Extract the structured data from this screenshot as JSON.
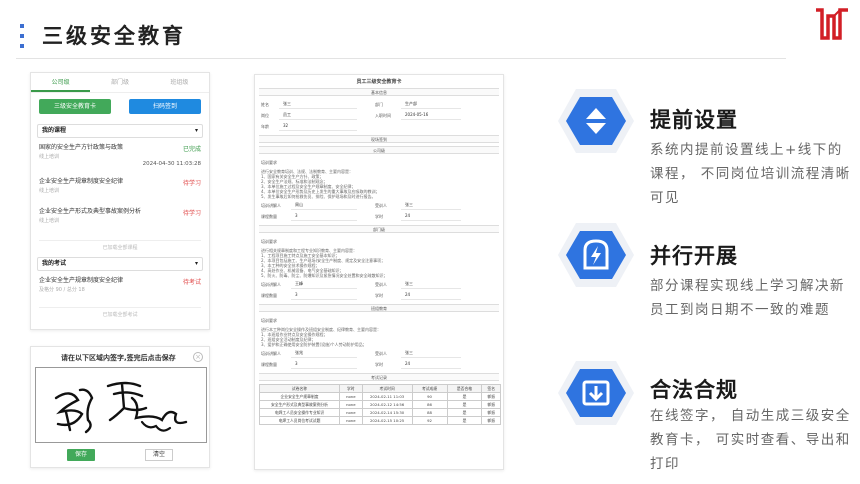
{
  "header": {
    "title": "三级安全教育"
  },
  "phone": {
    "tabs": [
      "公司级",
      "部门级",
      "班组级"
    ],
    "btn_card": "三级安全教育卡",
    "btn_scan": "扫码签到",
    "my_courses_label": "我的课程",
    "courses": [
      {
        "name": "国家的安全生产方针政策与政策",
        "sub": "线上培训",
        "status": "已完成",
        "time": "2024-04-30 11:03:28"
      },
      {
        "name": "企业安全生产规章制度安全纪律",
        "sub": "线上培训",
        "status": "待学习",
        "time": ""
      },
      {
        "name": "企业安全生产形式及典型事故案例分析",
        "sub": "线上培训",
        "status": "待学习",
        "time": ""
      }
    ],
    "courses_more": "已加载全部课程",
    "my_exams_label": "我的考试",
    "exams": [
      {
        "name": "企业安全生产规章制度安全纪律",
        "sub": "及格分 90 / 总分 18",
        "status": "待考试"
      }
    ],
    "exams_more": "已加载全部考试"
  },
  "signature": {
    "title": "请在以下区域内签字,签完后点击保存",
    "save": "保存",
    "clear": "清空"
  },
  "doc": {
    "title": "员工三级安全教育卡",
    "basic_label": "基本信息",
    "name_key": "姓名",
    "name_val": "张三",
    "dept_key": "部门",
    "dept_val": "生产部",
    "post_key": "岗位",
    "post_val": "员工",
    "entry_key": "入职时间",
    "entry_val": "2024-05-16",
    "age_key": "年龄",
    "age_val": "32",
    "sign_label": "现场签到",
    "company_label": "公司级",
    "dept_level_label": "部门级",
    "team_label": "班组教育",
    "exam_label": "考试记录",
    "req_label": "培训要求",
    "lines_company": [
      "进行安全教育培训、法规、法制教育、主要内容是：",
      "1、国家有关安全生产方针、政策；",
      "2、安全生产法规、标准和法制观念；",
      "3、本单位施工过程及安全生产规章制度、安全纪律；",
      "4、本单位安全生产形势及历史上发生的重大事故及应吸取的教训；",
      "5、发生事故后如何抢救伤员、排险、保护现场和及时进行报告。"
    ],
    "lines_dept": [
      "进行相关规章制度和工程专业知识教育、主要内容是：",
      "1、工程项目施工特点及施工安全基本知识；",
      "2、本项目包括施工、生产现场)安全生产制度、规定及安全注意事项；",
      "3、本工种的安全技术操作规程；",
      "4、高处作业、机械设备、电气安全基础知识；",
      "5、防火、防毒、防尘、防爆知识及紧急情况安全处置和安全疏散知识；"
    ],
    "lines_team": [
      "进行本工种岗位安全操作及班组安全制度、纪律教育、主要内容是：",
      "1、本班组作业特点及安全操作规程；",
      "2、班组安全活动制度及纪律；",
      "3、爱护和正确使用安全防护装置(设施)个人劳动防护用品；"
    ],
    "trainer_key": "培训讲解人",
    "trainee_key": "受训人",
    "hours_key": "课程数量",
    "score_key": "学时",
    "hours_val": "3",
    "score_val": "24",
    "trainer_name": "周山",
    "trainer2_name": "王峰",
    "trainer3_name": "张兆",
    "trainee_name": "张三",
    "table_headers": [
      "试卷名称",
      "学时",
      "考试时间",
      "考试成绩",
      "是否合格",
      "签名"
    ],
    "table_rows": [
      [
        "企业安全生产规章制度",
        "none",
        "2024-02-11 11:03",
        "90",
        "是",
        "郭振"
      ],
      [
        "安全生产形式及典型事故案例分析",
        "none",
        "2024-02-12 14:56",
        "86",
        "是",
        "郭振"
      ],
      [
        "电焊工人员安全操作专业知识",
        "none",
        "2024-02-14 15:30",
        "88",
        "是",
        "郭振"
      ],
      [
        "电焊工人员岗位考试试题",
        "none",
        "2024-02-15 10:25",
        "92",
        "是",
        "郭振"
      ]
    ]
  },
  "features": [
    {
      "title": "提前设置",
      "desc": "系统内提前设置线上+线下的课程， 不同岗位培训流程清晰可见",
      "icon": "expand-collapse-icon"
    },
    {
      "title": "并行开展",
      "desc": "部分课程实现线上学习解决新员工到岗日期不一致的难题",
      "icon": "flash-device-icon"
    },
    {
      "title": "合法合规",
      "desc": "在线签字， 自动生成三级安全教育卡， 可实时查看、导出和打印",
      "icon": "download-box-icon"
    }
  ],
  "colors": {
    "accent": "#2f74e0",
    "title_dark": "#222222",
    "green": "#42a95a",
    "red": "#e04848"
  }
}
